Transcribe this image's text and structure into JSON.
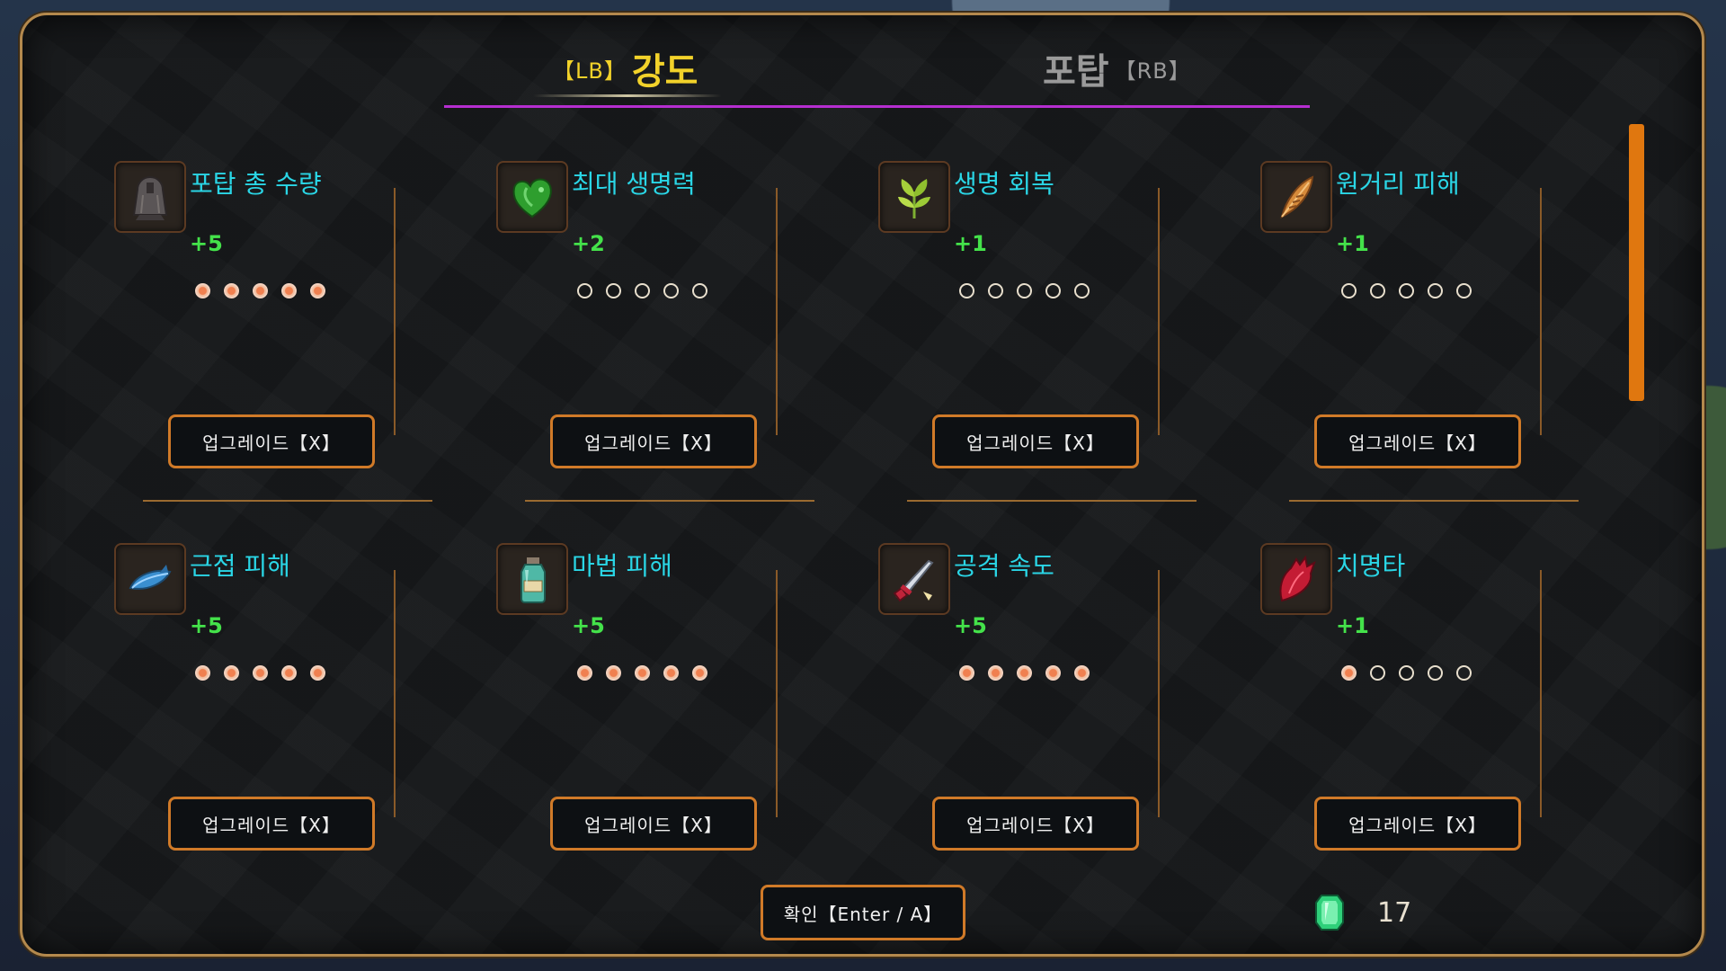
{
  "tabs": {
    "active": {
      "hint": "【LB】",
      "label": "강도"
    },
    "inactive": {
      "label": "포탑",
      "hint": "【RB】"
    }
  },
  "colors": {
    "title": "#2ad6e6",
    "bonus": "#44e24a",
    "tab_active": "#f2d22a",
    "tab_underline": "#b52ed0",
    "button_border": "#d07a28"
  },
  "upgrades": [
    {
      "icon": "turret-bell-icon",
      "title": "포탑 총 수량",
      "bonus": "+5",
      "level": 5,
      "max": 5,
      "button": "업그레이드【X】"
    },
    {
      "icon": "green-heart-icon",
      "title": "최대 생명력",
      "bonus": "+2",
      "level": 0,
      "max": 5,
      "button": "업그레이드【X】"
    },
    {
      "icon": "herb-sprout-icon",
      "title": "생명 회복",
      "bonus": "+1",
      "level": 0,
      "max": 5,
      "button": "업그레이드【X】"
    },
    {
      "icon": "feather-arrow-icon",
      "title": "원거리 피해",
      "bonus": "+1",
      "level": 0,
      "max": 5,
      "button": "업그레이드【X】"
    },
    {
      "icon": "blue-fish-icon",
      "title": "근접 피해",
      "bonus": "+5",
      "level": 5,
      "max": 5,
      "button": "업그레이드【X】"
    },
    {
      "icon": "potion-bottle-icon",
      "title": "마법 피해",
      "bonus": "+5",
      "level": 5,
      "max": 5,
      "button": "업그레이드【X】"
    },
    {
      "icon": "red-dagger-icon",
      "title": "공격 속도",
      "bonus": "+5",
      "level": 5,
      "max": 5,
      "button": "업그레이드【X】"
    },
    {
      "icon": "red-claw-icon",
      "title": "치명타",
      "bonus": "+1",
      "level": 1,
      "max": 5,
      "button": "업그레이드【X】"
    }
  ],
  "footer": {
    "confirm": "확인【Enter / A】",
    "currency_icon": "green-gem-icon",
    "currency": "17"
  }
}
